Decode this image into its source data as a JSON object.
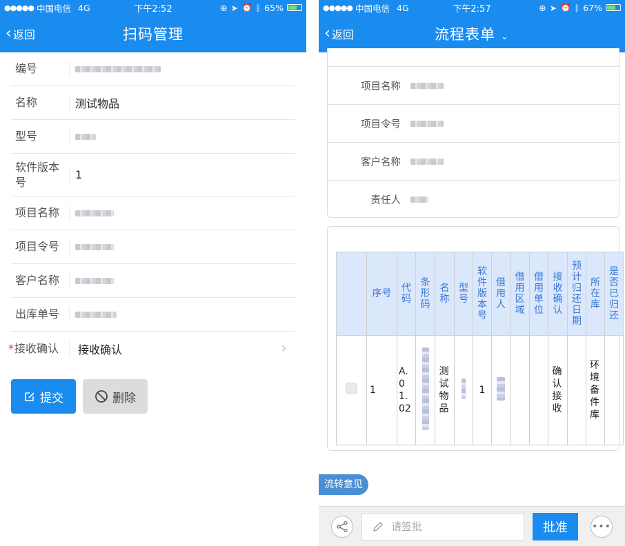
{
  "left": {
    "status": {
      "carrier": "中国电信",
      "network": "4G",
      "time": "下午2:52",
      "battery": "65%",
      "battery_level": 0.65
    },
    "nav": {
      "back": "返回",
      "title": "扫码管理"
    },
    "fields": [
      {
        "label": "编号",
        "value": ""
      },
      {
        "label": "名称",
        "value": "测试物品"
      },
      {
        "label": "型号",
        "value": ""
      },
      {
        "label": "软件版本号",
        "value": "1"
      },
      {
        "label": "项目名称",
        "value": ""
      },
      {
        "label": "项目令号",
        "value": ""
      },
      {
        "label": "客户名称",
        "value": ""
      },
      {
        "label": "出库单号",
        "value": ""
      },
      {
        "label": "接收确认",
        "value": "接收确认",
        "required": true
      }
    ],
    "buttons": {
      "submit": "提交",
      "delete": "删除"
    }
  },
  "right": {
    "status": {
      "carrier": "中国电信",
      "network": "4G",
      "time": "下午2:57",
      "battery": "67%",
      "battery_level": 0.67
    },
    "nav": {
      "back": "返回",
      "title": "流程表单"
    },
    "info": [
      {
        "label": "项目名称",
        "value": ""
      },
      {
        "label": "项目令号",
        "value": ""
      },
      {
        "label": "客户名称",
        "value": ""
      },
      {
        "label": "责任人",
        "value": ""
      }
    ],
    "table": {
      "headers": [
        "",
        "序号",
        "代码",
        "条形码",
        "名称",
        "型号",
        "软件版本号",
        "借用人",
        "借用区域",
        "借用单位",
        "接收确认",
        "预计归还日期",
        "所在库",
        "是否已归还"
      ],
      "row": {
        "seq": "1",
        "code": "A.01.02",
        "name": "测试物品",
        "version": "1",
        "confirm": "确认接收",
        "location": "环境备件库"
      }
    },
    "tag": "流转意见",
    "bottom": {
      "placeholder": "请签批",
      "approve": "批准"
    }
  },
  "colors": {
    "primary": "#1a8cf0",
    "header_bg": "#dbe7fb",
    "header_text": "#3a78d4",
    "required": "#e53935"
  }
}
